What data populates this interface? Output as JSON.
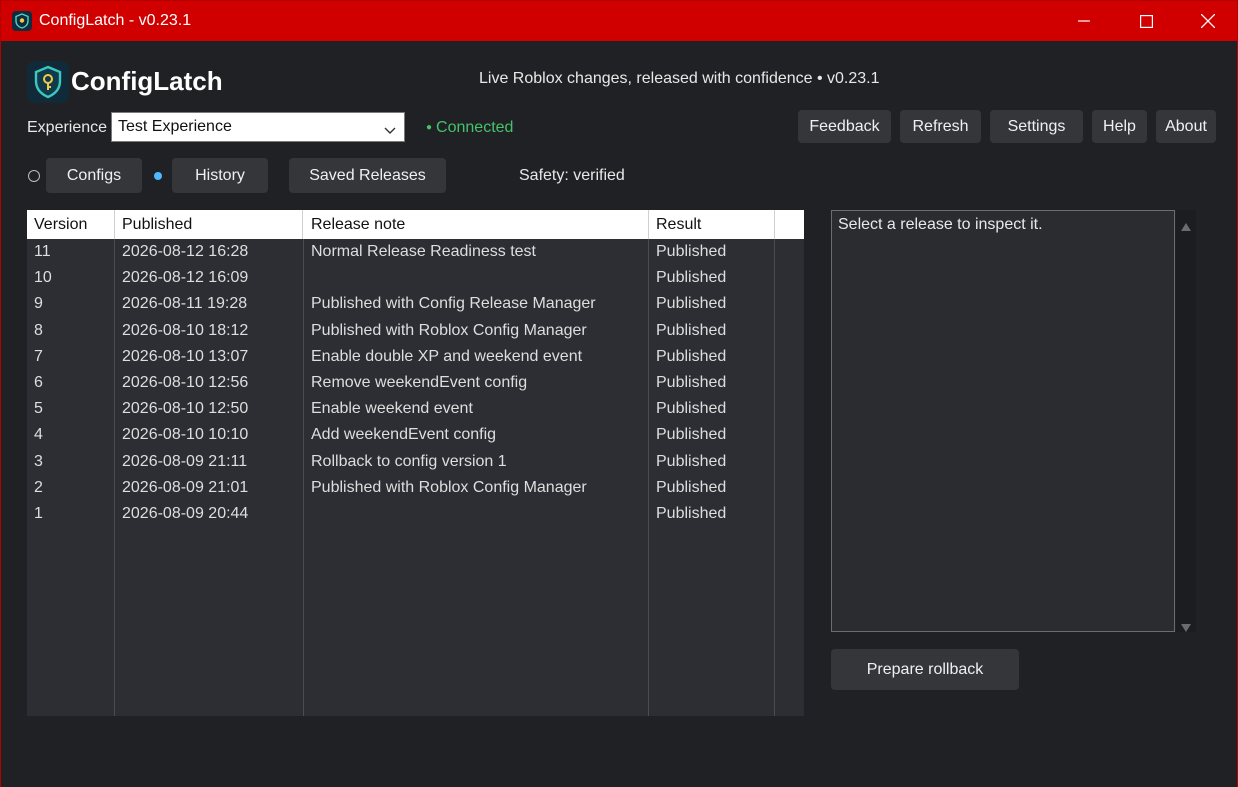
{
  "window": {
    "title": "ConfigLatch - v0.23.1",
    "titlebar_color": "#d00000",
    "controls": [
      "minimize-icon",
      "maximize-icon",
      "close-icon"
    ]
  },
  "header": {
    "brand": "ConfigLatch",
    "tagline": "Live Roblox changes, released with confidence  •  v0.23.1"
  },
  "experience": {
    "label": "Experience",
    "selected": "Test Experience",
    "status": "Connected",
    "status_color": "#45c26a"
  },
  "toolbar": {
    "feedback": "Feedback",
    "refresh": "Refresh",
    "settings": "Settings",
    "help": "Help",
    "about": "About"
  },
  "tabs": {
    "configs": "Configs",
    "history": "History",
    "saved_releases": "Saved Releases",
    "active": "History"
  },
  "safety": "Safety: verified",
  "table": {
    "headers": [
      "Version",
      "Published",
      "Release note",
      "Result"
    ],
    "rows": [
      {
        "version": "11",
        "published": "2026-08-12 16:28",
        "note": "Normal Release Readiness test",
        "result": "Published"
      },
      {
        "version": "10",
        "published": "2026-08-12 16:09",
        "note": "",
        "result": "Published"
      },
      {
        "version": "9",
        "published": "2026-08-11 19:28",
        "note": "Published with Config Release Manager",
        "result": "Published"
      },
      {
        "version": "8",
        "published": "2026-08-10 18:12",
        "note": "Published with Roblox Config Manager",
        "result": "Published"
      },
      {
        "version": "7",
        "published": "2026-08-10 13:07",
        "note": "Enable double XP and weekend event",
        "result": "Published"
      },
      {
        "version": "6",
        "published": "2026-08-10 12:56",
        "note": "Remove weekendEvent config",
        "result": "Published"
      },
      {
        "version": "5",
        "published": "2026-08-10 12:50",
        "note": "Enable weekend event",
        "result": "Published"
      },
      {
        "version": "4",
        "published": "2026-08-10 10:10",
        "note": "Add weekendEvent config",
        "result": "Published"
      },
      {
        "version": "3",
        "published": "2026-08-09 21:11",
        "note": "Rollback to config version 1",
        "result": "Published"
      },
      {
        "version": "2",
        "published": "2026-08-09 21:01",
        "note": "Published with Roblox Config Manager",
        "result": "Published"
      },
      {
        "version": "1",
        "published": "2026-08-09 20:44",
        "note": "",
        "result": "Published"
      }
    ]
  },
  "inspector": {
    "placeholder": "Select a release to inspect it.",
    "rollback_label": "Prepare rollback"
  }
}
